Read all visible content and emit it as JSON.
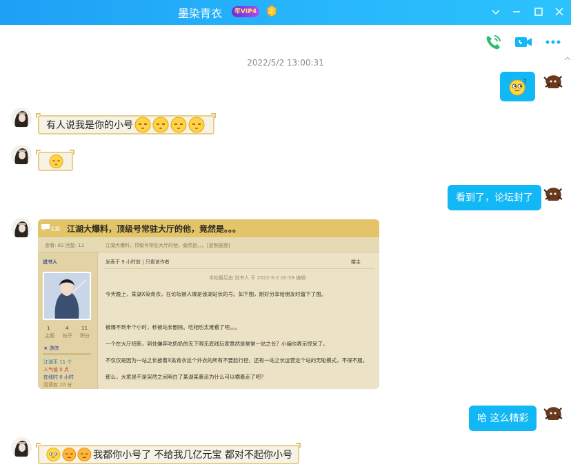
{
  "window": {
    "title": "墨染青衣",
    "vip_label": "年VIP4",
    "controls": [
      "chevron-down-icon",
      "minimize-icon",
      "maximize-icon",
      "close-icon"
    ]
  },
  "toolbar": {
    "icons": [
      "voice-call-icon",
      "video-call-icon",
      "more-icon"
    ],
    "accent_color": "#12b7f5"
  },
  "chat": {
    "timestamp": "2022/5/2 13:00:31",
    "messages": [
      {
        "side": "right",
        "type": "emoji",
        "emoji": "thinking-face"
      },
      {
        "side": "left",
        "type": "text",
        "text": "有人说我是你的小号",
        "emoji_count": 4
      },
      {
        "side": "left",
        "type": "emoji",
        "emoji": "sleepy-face"
      },
      {
        "side": "right",
        "type": "text",
        "text": "看到了，论坛封了"
      },
      {
        "side": "left",
        "type": "image"
      },
      {
        "side": "right",
        "type": "text",
        "text": "哈  这么精彩"
      },
      {
        "side": "left",
        "type": "text",
        "text": "我都你小号了  不给我几亿元宝 都对不起你小号",
        "emoji_count": 3
      }
    ]
  },
  "forum_screenshot": {
    "tag": "主题",
    "title": "江湖大爆料，顶级号常驻大厅的他，竟然是。。。",
    "stats": "查看: 82  回复: 11",
    "breadcrumb": "江湖大爆料，顶级号常驻大厅的他，竟然是。。。[复制链接]",
    "author": "说书人",
    "author_stats": [
      "1",
      "4",
      "11"
    ],
    "author_stat_labels": [
      "主题",
      "帖子",
      "积分"
    ],
    "rank": "游侠",
    "user_fields": [
      "江湖币 11 个",
      "人气值 0 点",
      "在线时 0 小时",
      "阅读权 10 分"
    ],
    "post_meta": "发表于 9 小时前  |  只看该作者",
    "floor": "楼主",
    "edit_note": "本帖最后由 说书人 于 2022-5-2 00:59 编辑",
    "body": [
      "今天晚上，某湖X染青衣，在论坛被人爆是该湖站长的号。如下图，刚好分享给朋友时留下了图。",
      "",
      "",
      "被爆不到半个小时，秒被站长删除。吃相也太难看了吧。。。",
      "一个在大厅招新，到处嫌弃吃奶奶的无下限无底线玩家竟然是堂堂一站之长？小编也表示惊呆了。",
      "不仅仅是因为一站之长披着X染青衣这个外衣的所有不要脸行径，还有一站之长运营这个站的无耻模式，不得不服。",
      "那么，大家是不是突然之间明白了某湖某董派为什么可以横着走了吧？"
    ]
  }
}
